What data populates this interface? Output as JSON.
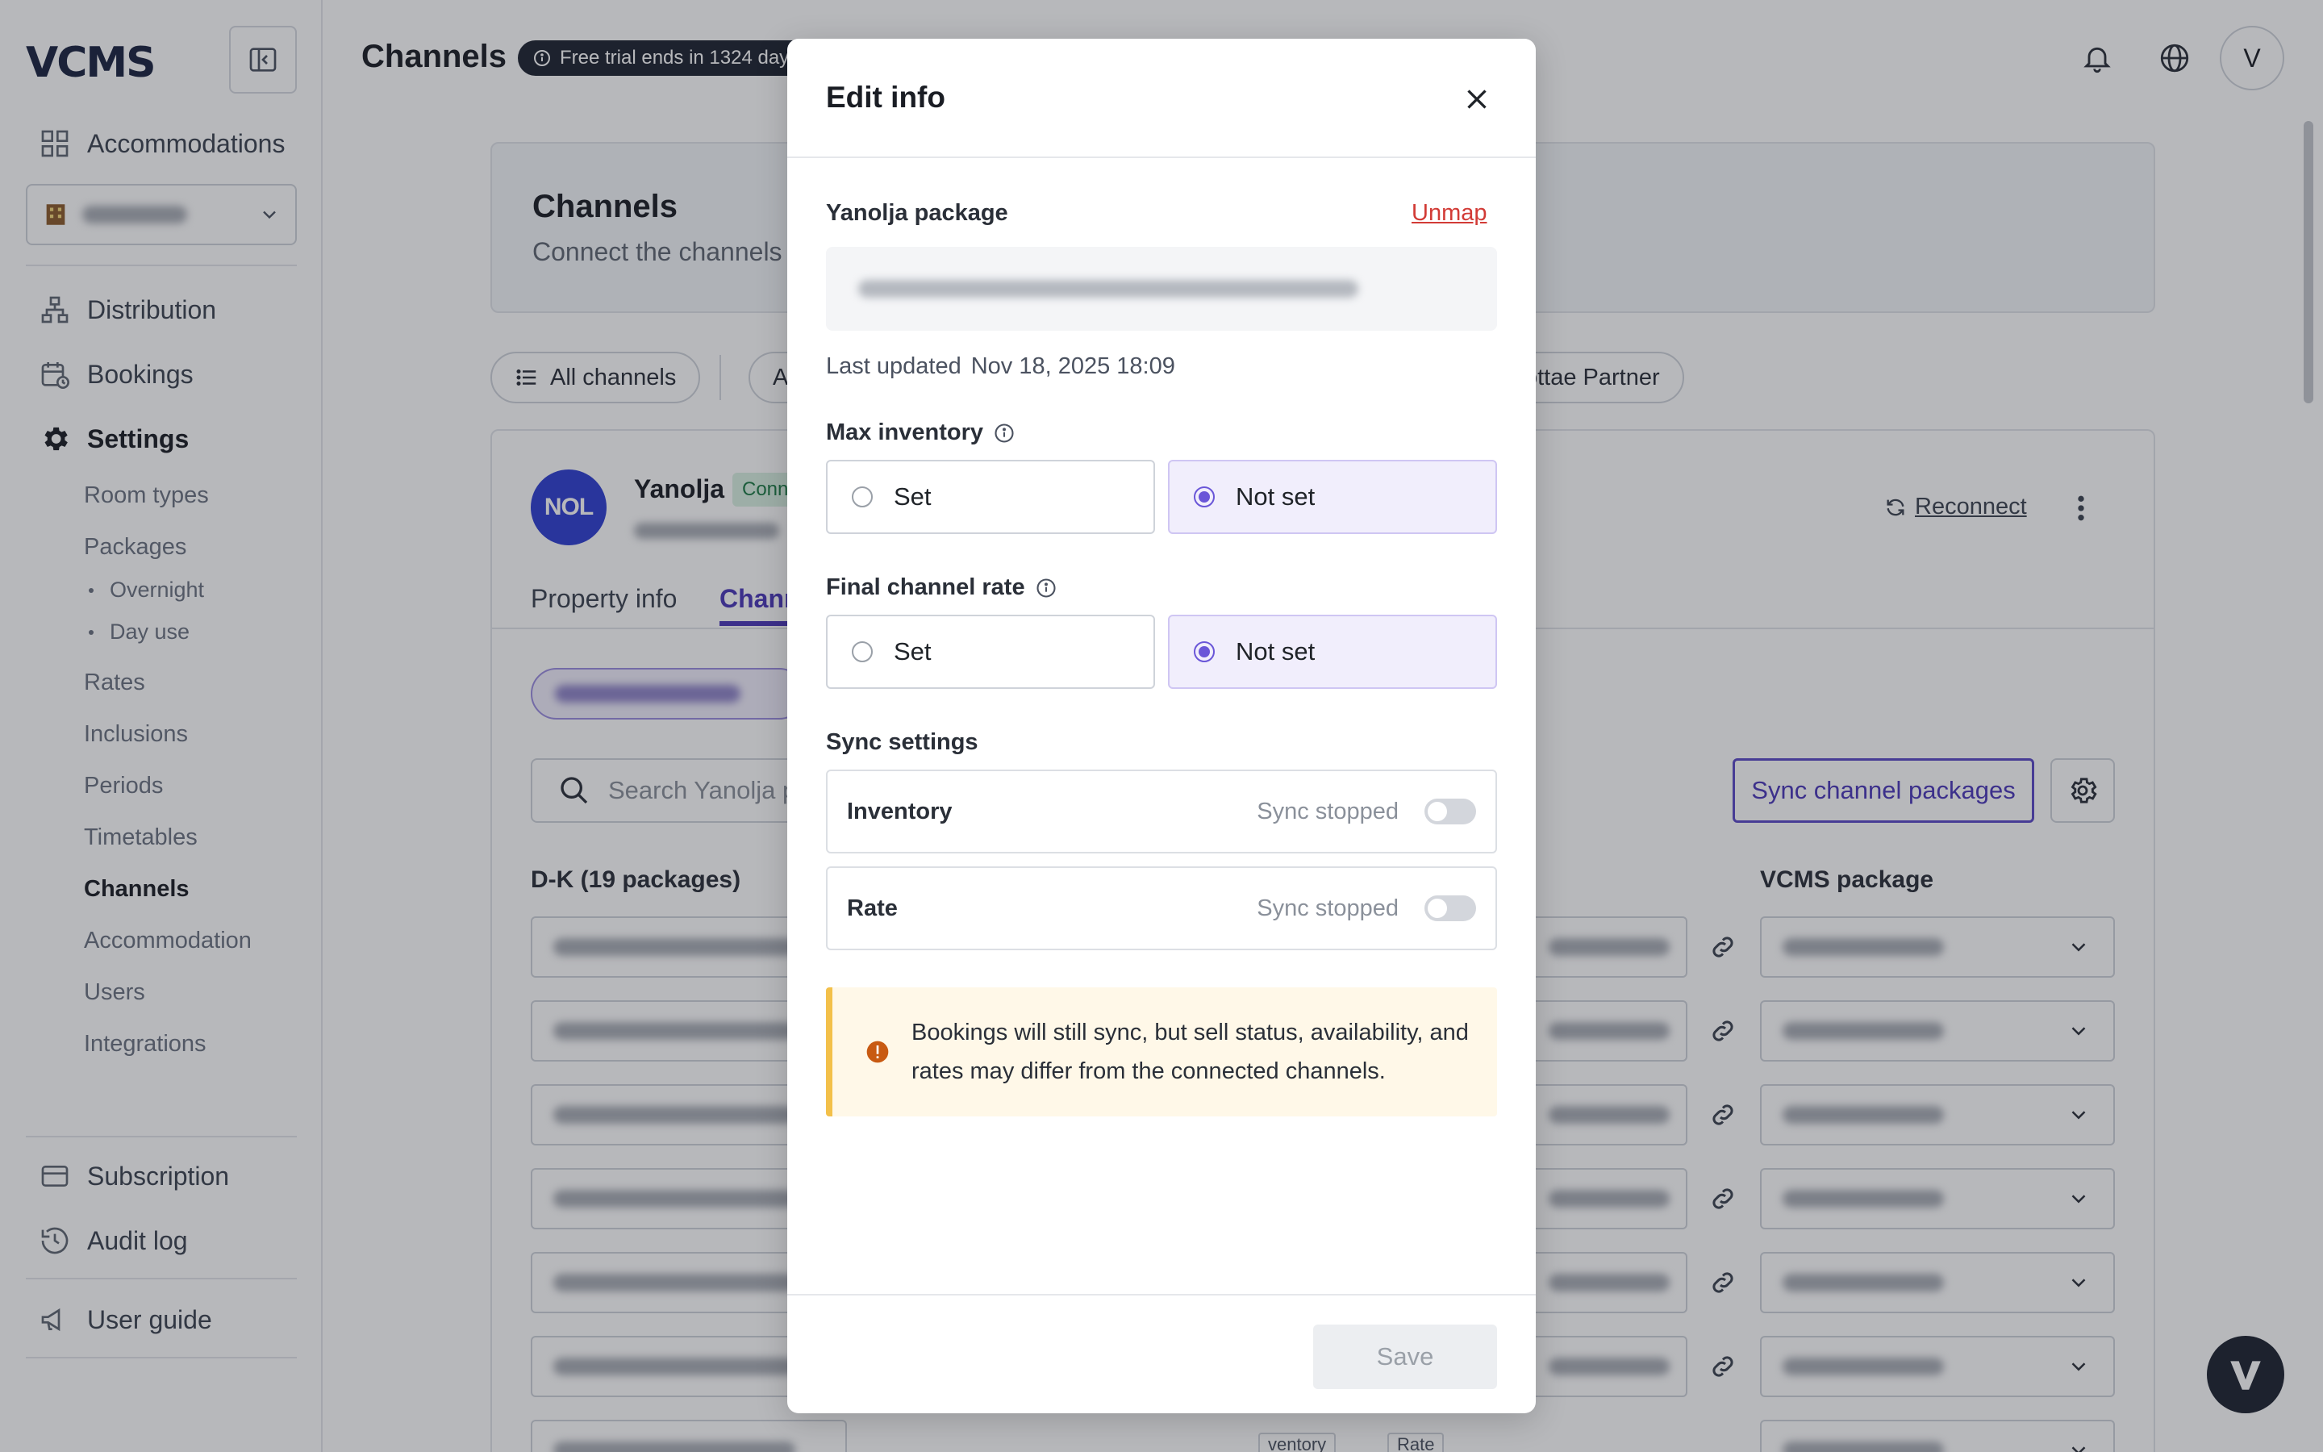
{
  "app": {
    "logo": "VCMS",
    "page_title": "Channels",
    "trial_badge": "Free trial ends in 1324 days",
    "avatar_initial": "V"
  },
  "sidebar": {
    "accommodations": "Accommodations",
    "property_selected": "",
    "distribution": "Distribution",
    "bookings": "Bookings",
    "settings": "Settings",
    "settings_items": [
      "Room types",
      "Packages",
      "Overnight",
      "Day use",
      "Rates",
      "Inclusions",
      "Periods",
      "Timetables",
      "Channels",
      "Accommodation",
      "Users",
      "Integrations"
    ],
    "subscription": "Subscription",
    "audit_log": "Audit log",
    "user_guide": "User guide"
  },
  "main": {
    "panel_title": "Channels",
    "panel_subtitle": "Connect the channels",
    "filter_all": "All channels",
    "filter_partial": "Ag",
    "filter_partner": "ottae Partner",
    "channel_logo": "NOL",
    "channel_name": "Yanolja",
    "channel_status": "Conn",
    "reconnect": "Reconnect",
    "tab_property": "Property info",
    "tab_channel": "Chann",
    "search_placeholder": "Search Yanolja p",
    "sync_button": "Sync channel packages",
    "col_left": "D-K (19 packages)",
    "col_right": "VCMS package",
    "row_tags": [
      "ventory",
      "Rate"
    ]
  },
  "modal": {
    "title": "Edit info",
    "package_label": "Yanolja package",
    "unmap": "Unmap",
    "last_updated_label": "Last updated",
    "last_updated_value": "Nov 18, 2025 18:09",
    "max_inventory_label": "Max inventory",
    "final_rate_label": "Final channel rate",
    "option_set": "Set",
    "option_not_set": "Not set",
    "max_inventory_selected": "Not set",
    "final_rate_selected": "Not set",
    "sync_settings_label": "Sync settings",
    "sync_inventory_label": "Inventory",
    "sync_rate_label": "Rate",
    "sync_status": "Sync stopped",
    "sync_inventory_on": false,
    "sync_rate_on": false,
    "warning": "Bookings will still sync, but sell status, availability, and rates may differ from the connected channels.",
    "save": "Save"
  },
  "colors": {
    "accent": "#6a56d8",
    "danger": "#d23b36",
    "warning_bg": "#fff8e8",
    "warning_border": "#f3c04a",
    "brand_dark": "#1c2230",
    "nol_blue": "#2f3fd1"
  }
}
